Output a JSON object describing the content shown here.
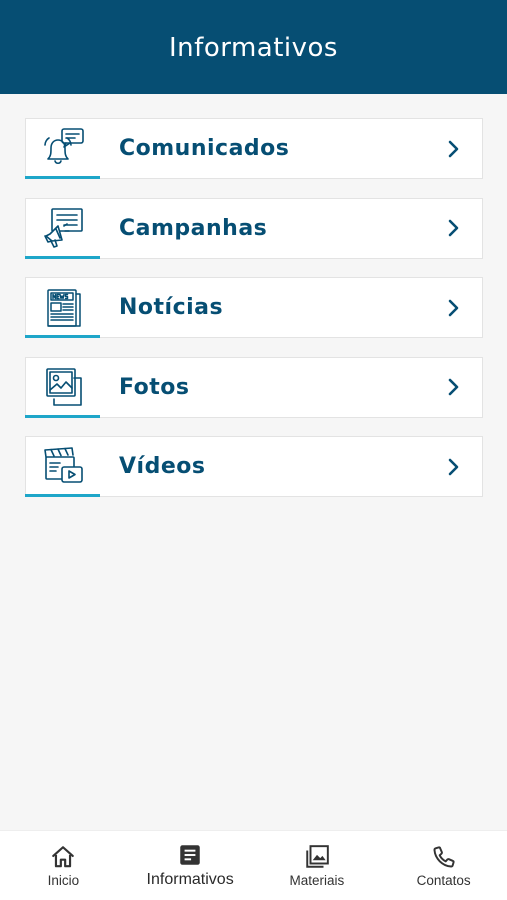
{
  "header": {
    "title": "Informativos"
  },
  "colors": {
    "primary": "#064e73",
    "accent": "#1ea6c9",
    "background": "#f6f6f6"
  },
  "menu": [
    {
      "label": "Comunicados",
      "icon": "bell-chat-icon"
    },
    {
      "label": "Campanhas",
      "icon": "megaphone-icon"
    },
    {
      "label": "Notícias",
      "icon": "newspaper-icon"
    },
    {
      "label": "Fotos",
      "icon": "photos-icon"
    },
    {
      "label": "Vídeos",
      "icon": "video-icon"
    }
  ],
  "bottom_nav": [
    {
      "label": "Inicio",
      "icon": "home-icon",
      "active": false
    },
    {
      "label": "Informativos",
      "icon": "document-icon",
      "active": true
    },
    {
      "label": "Materiais",
      "icon": "gallery-icon",
      "active": false
    },
    {
      "label": "Contatos",
      "icon": "phone-icon",
      "active": false
    }
  ]
}
